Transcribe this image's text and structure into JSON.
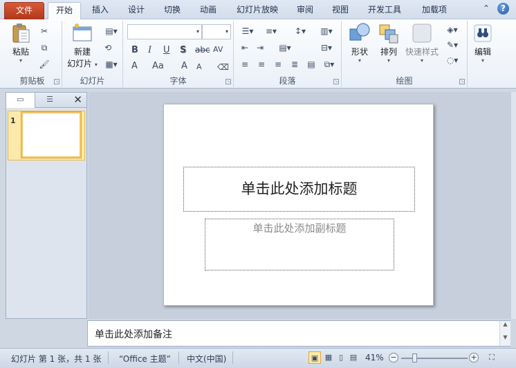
{
  "tabs": [
    {
      "label": "文件"
    },
    {
      "label": "开始"
    },
    {
      "label": "插入"
    },
    {
      "label": "设计"
    },
    {
      "label": "切换"
    },
    {
      "label": "动画"
    },
    {
      "label": "幻灯片放映"
    },
    {
      "label": "审阅"
    },
    {
      "label": "视图"
    },
    {
      "label": "开发工具"
    },
    {
      "label": "加载项"
    }
  ],
  "ribbon": {
    "clipboard": {
      "paste_label": "粘贴",
      "group_label": "剪贴板"
    },
    "slides": {
      "new_slide_line1": "新建",
      "new_slide_line2": "幻灯片",
      "group_label": "幻灯片"
    },
    "font": {
      "group_label": "字体",
      "bold": "B",
      "italic": "I",
      "underline": "U",
      "shadow": "S",
      "strike": "abc",
      "spacing": "AV",
      "grow": "A",
      "shrink": "A",
      "case": "Aa",
      "color": "A"
    },
    "paragraph": {
      "group_label": "段落"
    },
    "drawing": {
      "shapes_label": "形状",
      "arrange_label": "排列",
      "quickstyles_label": "快速样式",
      "group_label": "绘图"
    },
    "editing": {
      "edit_label": "编辑"
    }
  },
  "left_pane": {
    "slide_number": "1"
  },
  "slide": {
    "title_placeholder": "单击此处添加标题",
    "subtitle_placeholder": "单击此处添加副标题"
  },
  "notes": {
    "placeholder": "单击此处添加备注"
  },
  "status": {
    "slide_info": "幻灯片 第 1 张，共 1 张",
    "theme": "“Office 主题”",
    "language": "中文(中国)",
    "zoom": "41%"
  }
}
